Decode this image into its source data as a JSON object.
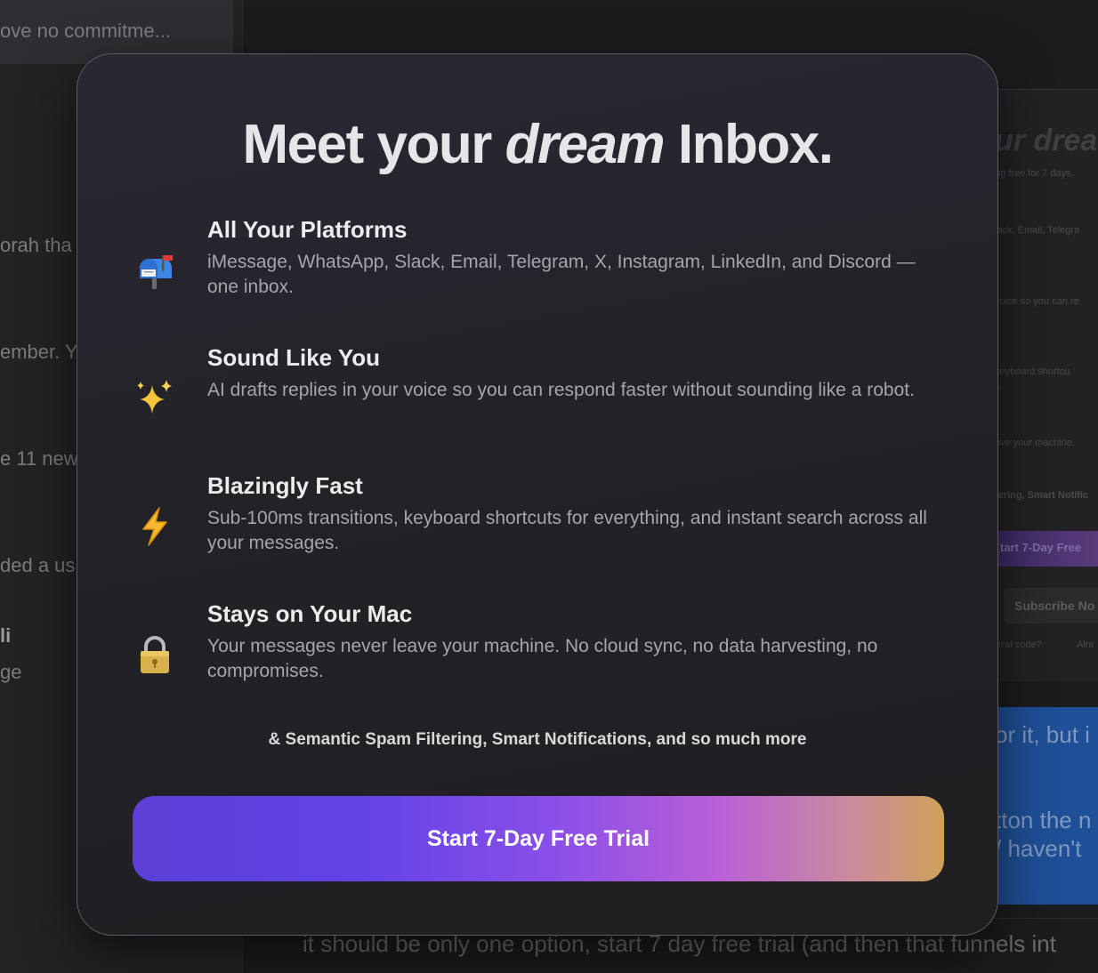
{
  "background": {
    "left_list": [
      "ove no commitme...",
      "orah tha",
      "ember. Y",
      "e 11 new",
      "ded a us",
      "li",
      "ge"
    ],
    "panel": {
      "title": "ur drea",
      "lines": [
        "ng free for 7 days.",
        "lack, Email, Telegra",
        "voice so you can re",
        "keyboard shortcu",
        "s.",
        "ave your machine.",
        "tering, Smart Notific",
        "rral code?",
        "Alre"
      ],
      "primary_button": "tart 7-Day Free",
      "secondary_button": "Subscribe No"
    },
    "blue_panel_lines": [
      "or it, but i",
      "tton the n",
      "/ haven't"
    ],
    "bottom_text": "it should be only one option, start 7 day free trial (and then that funnels int"
  },
  "modal": {
    "title_prefix": "Meet your ",
    "title_emphasis": "dream",
    "title_suffix": " Inbox.",
    "features": [
      {
        "icon": "mailbox-icon",
        "title": "All Your Platforms",
        "description": "iMessage, WhatsApp, Slack, Email, Telegram, X, Instagram, LinkedIn, and Discord — one inbox."
      },
      {
        "icon": "sparkles-icon",
        "title": "Sound Like You",
        "description": "AI drafts replies in your voice so you can respond faster without sounding like a robot."
      },
      {
        "icon": "lightning-icon",
        "title": "Blazingly Fast",
        "description": "Sub-100ms transitions, keyboard shortcuts for everything, and instant search across all your messages."
      },
      {
        "icon": "lock-icon",
        "title": "Stays on Your Mac",
        "description": "Your messages never leave your machine. No cloud sync, no data harvesting, no compromises."
      }
    ],
    "more_text": "& Semantic Spam Filtering, Smart Notifications, and so much more",
    "cta_label": "Start 7-Day Free Trial",
    "colors": {
      "cta_gradient_start": "#5b3fd6",
      "cta_gradient_mid": "#8a4fe8",
      "cta_gradient_end": "#cfa05a"
    }
  }
}
